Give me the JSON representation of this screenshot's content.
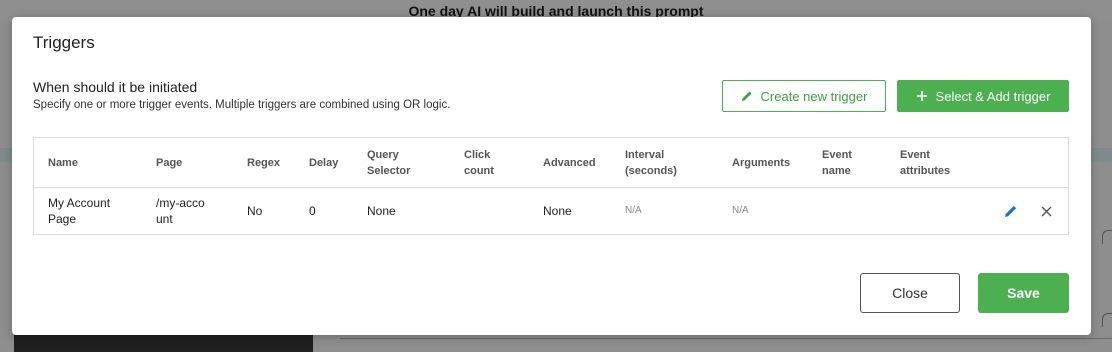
{
  "background": {
    "page_title": "One day AI will build and launch this prompt"
  },
  "modal": {
    "title": "Triggers",
    "heading": "When should it be initiated",
    "description": "Specify one or more trigger events. Multiple triggers are combined using OR logic.",
    "create_button": "Create new trigger",
    "select_add_button": "Select & Add trigger",
    "close_button": "Close",
    "save_button": "Save"
  },
  "table": {
    "columns": [
      "Name",
      "Page",
      "Regex",
      "Delay",
      "Query Selector",
      "Click count",
      "Advanced",
      "Interval (seconds)",
      "Arguments",
      "Event name",
      "Event attributes"
    ],
    "rows": [
      {
        "name": "My Account Page",
        "page": "/my-account",
        "regex": "No",
        "delay": "0",
        "query_selector": "None",
        "click_count": "",
        "advanced": "None",
        "interval": "N/A",
        "arguments": "N/A",
        "event_name": "",
        "event_attributes": ""
      }
    ]
  },
  "colors": {
    "accent_green": "#4caf50",
    "edit_icon_blue": "#1a73c8"
  },
  "icons": [
    "pencil-icon",
    "plus-icon",
    "edit-icon",
    "close-icon"
  ]
}
